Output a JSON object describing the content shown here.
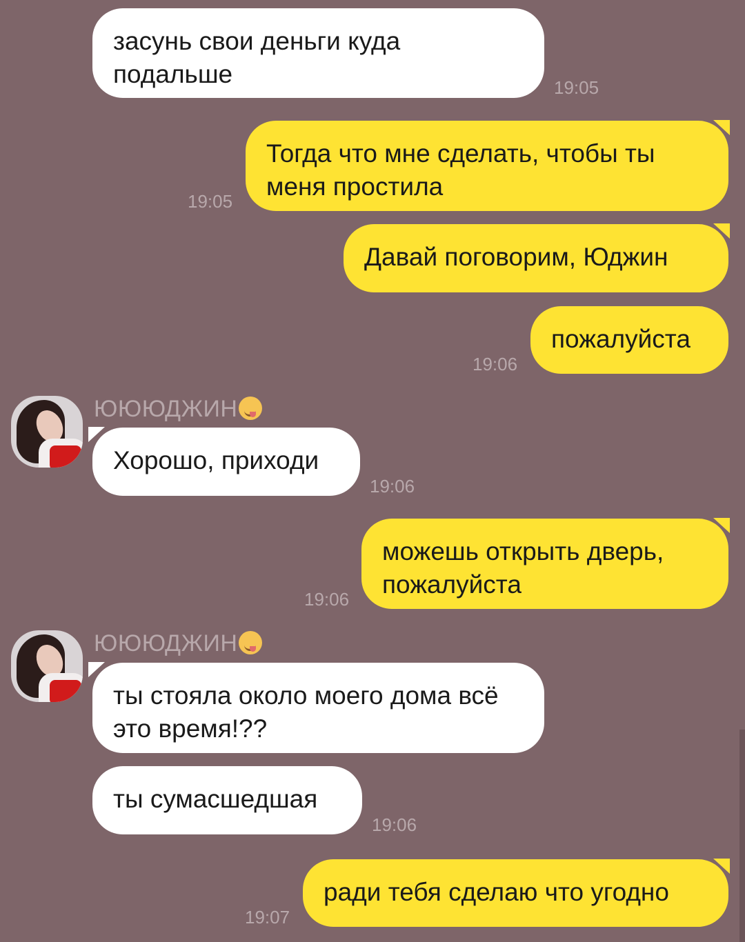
{
  "chat": {
    "contact_name": "ЮЮЮДЖИН",
    "contact_emoji": "yum-emoji-icon",
    "colors": {
      "background": "#7e6569",
      "outgoing": "#fee333",
      "incoming": "#ffffff"
    },
    "messages": [
      {
        "from": "them",
        "text": "засунь свои  деньги куда подальше",
        "time": "19:05"
      },
      {
        "from": "me",
        "text": "Тогда что мне сделать, чтобы ты меня простила",
        "time": "19:05"
      },
      {
        "from": "me",
        "text": "Давай поговорим, Юджин",
        "time": ""
      },
      {
        "from": "me",
        "text": "пожалуйста",
        "time": "19:06"
      },
      {
        "from": "them",
        "text": "Хорошо, приходи",
        "time": "19:06",
        "sender": "ЮЮЮДЖИН"
      },
      {
        "from": "me",
        "text": "можешь открыть дверь, пожалуйста",
        "time": "19:06"
      },
      {
        "from": "them",
        "text": "ты стояла около моего дома всё это время!??",
        "time": "",
        "sender": "ЮЮЮДЖИН"
      },
      {
        "from": "them",
        "text": "ты сумасшедшая",
        "time": "19:06"
      },
      {
        "from": "me",
        "text": "ради тебя сделаю что угодно",
        "time": "19:07"
      }
    ]
  }
}
